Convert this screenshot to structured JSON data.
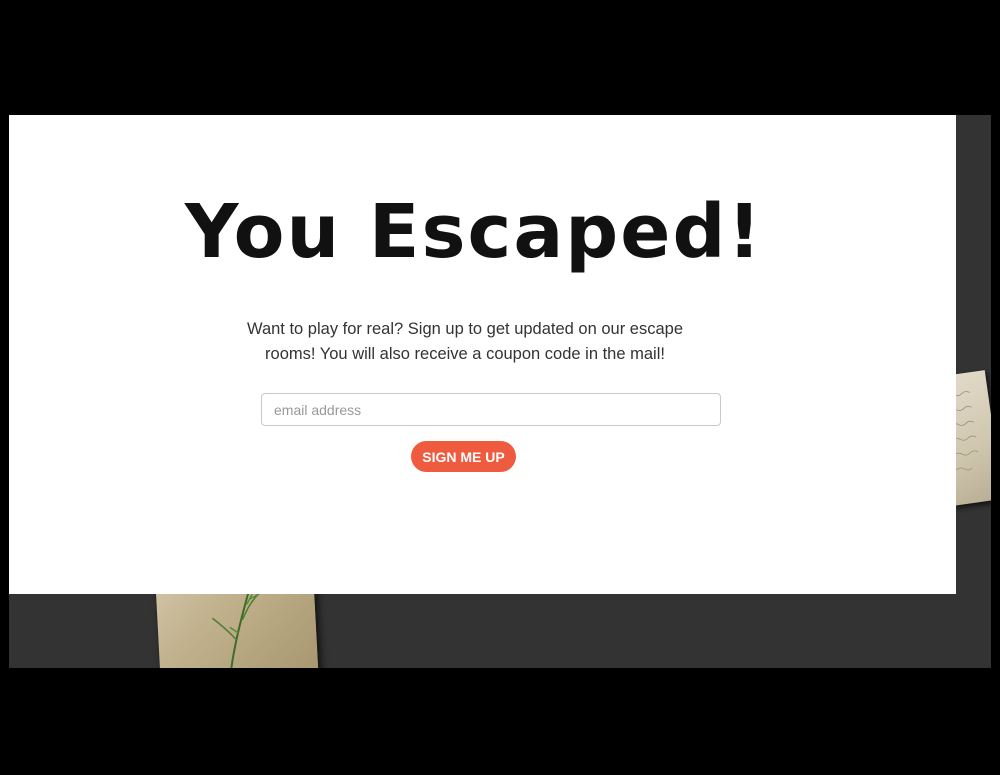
{
  "modal": {
    "headline": "You Escaped!",
    "message": "Want to play for real? Sign up to get updated on our escape rooms! You will also receive a coupon code in the mail!",
    "email_placeholder": "email address",
    "email_value": "",
    "signup_label": "SIGN ME UP"
  },
  "colors": {
    "backdrop": "#333333",
    "modal_background": "#ffffff",
    "button": "#ef5b3f",
    "headline": "#111111"
  },
  "background_items": [
    {
      "name": "botanical-card",
      "icon": "herb-illustration"
    },
    {
      "name": "handwritten-note-card",
      "icon": "handwriting"
    }
  ]
}
